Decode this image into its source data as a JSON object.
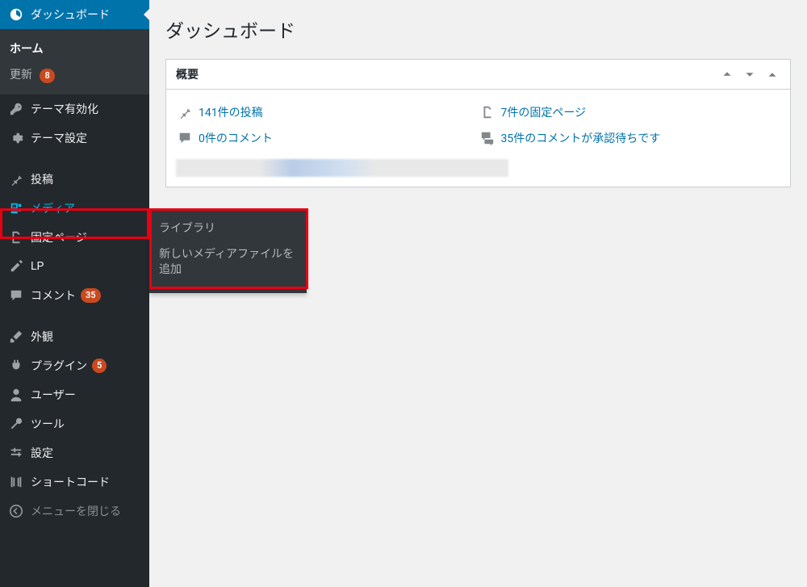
{
  "page": {
    "title": "ダッシュボード"
  },
  "sidebar": {
    "dashboard": "ダッシュボード",
    "home": "ホーム",
    "updates": "更新",
    "updates_badge": "8",
    "theme_activate": "テーマ有効化",
    "theme_settings": "テーマ設定",
    "posts": "投稿",
    "media": "メディア",
    "pages": "固定ページ",
    "lp": "LP",
    "comments": "コメント",
    "comments_badge": "35",
    "appearance": "外観",
    "plugins": "プラグイン",
    "plugins_badge": "5",
    "users": "ユーザー",
    "tools": "ツール",
    "settings": "設定",
    "shortcodes": "ショートコード",
    "collapse": "メニューを閉じる"
  },
  "flyout": {
    "library": "ライブラリ",
    "add_new": "新しいメディアファイルを追加"
  },
  "overview": {
    "title": "概要",
    "posts": "141件の投稿",
    "pages": "7件の固定ページ",
    "comments": "0件のコメント",
    "pending_comments": "35件のコメントが承認待ちです"
  }
}
